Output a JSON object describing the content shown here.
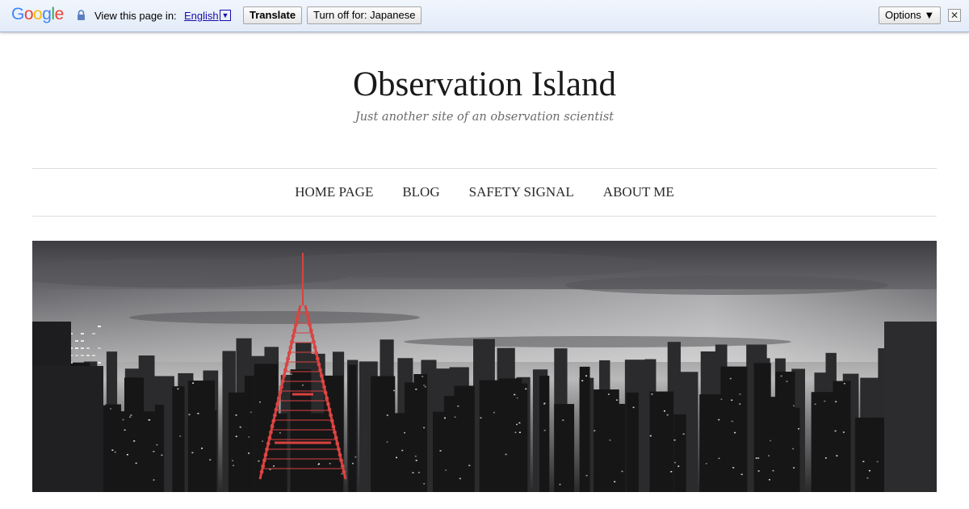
{
  "translate_bar": {
    "logo_letters": [
      "G",
      "o",
      "o",
      "g",
      "l",
      "e"
    ],
    "logo_colors": [
      "#4285f4",
      "#ea4335",
      "#fbbc05",
      "#4285f4",
      "#34a853",
      "#ea4335"
    ],
    "view_text": "View this page in:",
    "language": "English",
    "language_dropdown": "▼",
    "translate_button": "Translate",
    "turn_off_button": "Turn off for: Japanese",
    "options_button": "Options ▼",
    "close": "✕"
  },
  "site": {
    "title": "Observation Island",
    "tagline": "Just another site of an observation scientist"
  },
  "nav": {
    "items": [
      "HOME PAGE",
      "BLOG",
      "SAFETY SIGNAL",
      "ABOUT ME"
    ]
  },
  "hero": {
    "icon": "city-skyline-image",
    "tower_color": "#d9423f"
  }
}
